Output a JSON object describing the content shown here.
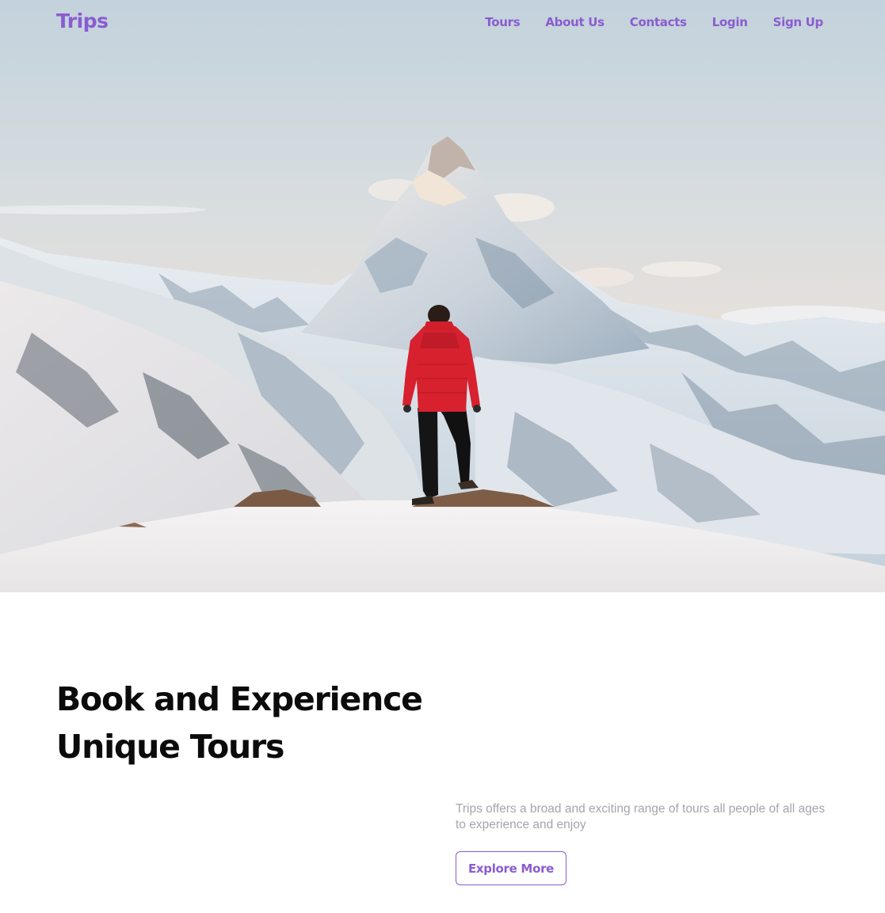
{
  "brand": {
    "name": "Trips",
    "accent_color": "#8a5cd0"
  },
  "nav": {
    "items": [
      {
        "label": "Tours"
      },
      {
        "label": "About Us"
      },
      {
        "label": "Contacts"
      },
      {
        "label": "Login"
      },
      {
        "label": "Sign Up"
      }
    ]
  },
  "hero": {
    "image": "snowy-mountain-peak-with-hiker-in-red-jacket"
  },
  "main": {
    "headline": "Book and Experience Unique Tours",
    "description": "Trips offers a broad and exciting range of tours all people of all ages to experience and enjoy",
    "cta_label": "Explore More"
  }
}
